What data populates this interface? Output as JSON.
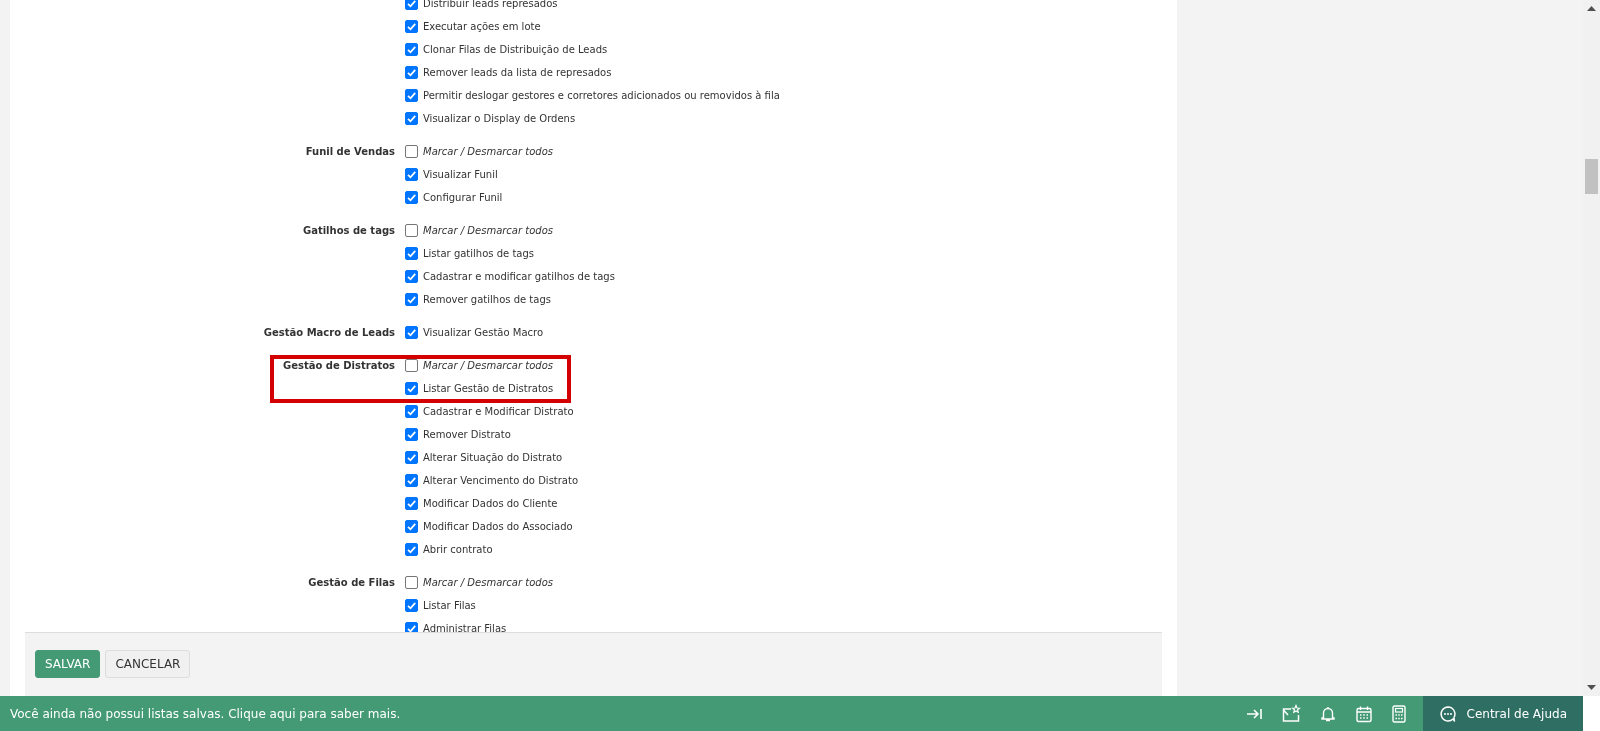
{
  "permission_groups": [
    {
      "highlighted": false,
      "items": [
        {
          "kind": "permission",
          "text": "Distribuir leads represados",
          "checked": true
        },
        {
          "kind": "permission",
          "text": "Executar ações em lote",
          "checked": true
        },
        {
          "kind": "permission",
          "text": "Clonar Filas de Distribuição de Leads",
          "checked": true
        },
        {
          "kind": "permission",
          "text": "Remover leads da lista de represados",
          "checked": true
        },
        {
          "kind": "permission",
          "text": "Permitir deslogar gestores e corretores adicionados ou removidos à fila",
          "checked": true
        },
        {
          "kind": "permission",
          "text": "Visualizar o Display de Ordens",
          "checked": true
        }
      ]
    },
    {
      "label": "Funil de Vendas",
      "highlighted": false,
      "items": [
        {
          "kind": "toggle_all",
          "text": "Marcar / Desmarcar todos",
          "checked": false
        },
        {
          "kind": "permission",
          "text": "Visualizar Funil",
          "checked": true
        },
        {
          "kind": "permission",
          "text": "Configurar Funil",
          "checked": true
        }
      ]
    },
    {
      "label": "Gatilhos de tags",
      "highlighted": false,
      "items": [
        {
          "kind": "toggle_all",
          "text": "Marcar / Desmarcar todos",
          "checked": false
        },
        {
          "kind": "permission",
          "text": "Listar gatilhos de tags",
          "checked": true
        },
        {
          "kind": "permission",
          "text": "Cadastrar e modificar gatilhos de tags",
          "checked": true
        },
        {
          "kind": "permission",
          "text": "Remover gatilhos de tags",
          "checked": true
        }
      ]
    },
    {
      "label": "Gestão Macro de Leads",
      "highlighted": false,
      "items": [
        {
          "kind": "permission",
          "text": "Visualizar Gestão Macro",
          "checked": true
        }
      ]
    },
    {
      "label": "Gestão de Distratos",
      "highlighted": true,
      "items": [
        {
          "kind": "toggle_all",
          "text": "Marcar / Desmarcar todos",
          "checked": false
        },
        {
          "kind": "permission",
          "text": "Listar Gestão de Distratos",
          "checked": true
        },
        {
          "kind": "permission",
          "text": "Cadastrar e Modificar Distrato",
          "checked": true
        },
        {
          "kind": "permission",
          "text": "Remover Distrato",
          "checked": true
        },
        {
          "kind": "permission",
          "text": "Alterar Situação do Distrato",
          "checked": true
        },
        {
          "kind": "permission",
          "text": "Alterar Vencimento do Distrato",
          "checked": true
        },
        {
          "kind": "permission",
          "text": "Modificar Dados do Cliente",
          "checked": true
        },
        {
          "kind": "permission",
          "text": "Modificar Dados do Associado",
          "checked": true
        },
        {
          "kind": "permission",
          "text": "Abrir contrato",
          "checked": true
        }
      ]
    },
    {
      "label": "Gestão de Filas",
      "highlighted": false,
      "items": [
        {
          "kind": "toggle_all",
          "text": "Marcar / Desmarcar todos",
          "checked": false
        },
        {
          "kind": "permission",
          "text": "Listar Filas",
          "checked": true
        },
        {
          "kind": "permission",
          "text": "Administrar Filas",
          "checked": true
        }
      ]
    }
  ],
  "form_buttons": [
    {
      "kind": "primary",
      "label": "SALVAR"
    },
    {
      "kind": "secondary",
      "label": "CANCELAR"
    }
  ],
  "bottom_bar": {
    "message": "Você ainda não possui listas salvas. Clique aqui para saber mais.",
    "help_label": "Central de Ajuda"
  }
}
